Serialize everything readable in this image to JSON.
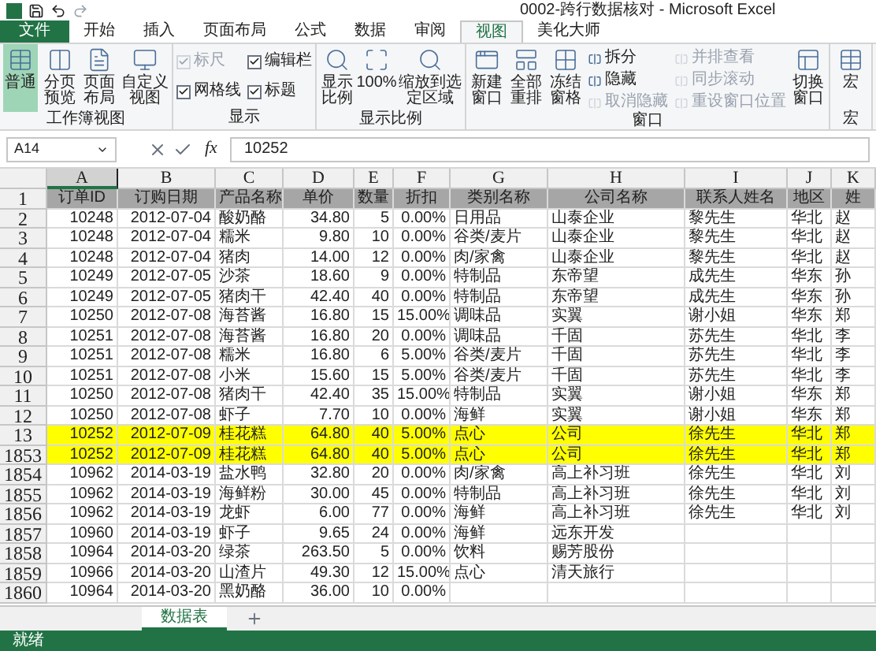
{
  "window": {
    "title": "0002-跨行数据核对 - Microsoft Excel"
  },
  "tabs": [
    {
      "label": "文件",
      "kind": "file",
      "selected": false
    },
    {
      "label": "开始",
      "kind": "tab",
      "selected": false
    },
    {
      "label": "插入",
      "kind": "tab",
      "selected": false
    },
    {
      "label": "页面布局",
      "kind": "tab",
      "selected": false
    },
    {
      "label": "公式",
      "kind": "tab",
      "selected": false
    },
    {
      "label": "数据",
      "kind": "tab",
      "selected": false
    },
    {
      "label": "审阅",
      "kind": "tab",
      "selected": false
    },
    {
      "label": "视图",
      "kind": "tab",
      "selected": true
    },
    {
      "label": "美化大师",
      "kind": "tab",
      "selected": false
    }
  ],
  "ribbon_groups": [
    {
      "label": "工作簿视图",
      "items": [
        {
          "kind": "large",
          "label": "普通",
          "selected": true
        },
        {
          "kind": "large",
          "label": "分页预览",
          "selected": false
        },
        {
          "kind": "large",
          "label": "页面布局",
          "selected": false
        },
        {
          "kind": "large",
          "label": "自定义视图",
          "selected": false
        }
      ]
    },
    {
      "label": "显示",
      "items": [
        {
          "kind": "check",
          "label": "标尺",
          "checked": true,
          "disabled": true
        },
        {
          "kind": "check",
          "label": "网格线",
          "checked": true,
          "disabled": false
        },
        {
          "kind": "check",
          "label": "编辑栏",
          "checked": true,
          "disabled": false
        },
        {
          "kind": "check",
          "label": "标题",
          "checked": true,
          "disabled": false
        }
      ]
    },
    {
      "label": "显示比例",
      "items": [
        {
          "kind": "large",
          "label": "显示比例",
          "selected": false
        },
        {
          "kind": "large",
          "label": "100%",
          "selected": false
        },
        {
          "kind": "large",
          "label": "缩放到选定区域",
          "selected": false
        }
      ]
    },
    {
      "label": "窗口",
      "items": [
        {
          "kind": "large",
          "label": "新建窗口",
          "selected": false
        },
        {
          "kind": "large",
          "label": "全部重排",
          "selected": false
        },
        {
          "kind": "large",
          "label": "冻结窗格",
          "selected": false
        },
        {
          "kind": "small",
          "label": "拆分",
          "disabled": false
        },
        {
          "kind": "small",
          "label": "隐藏",
          "disabled": false
        },
        {
          "kind": "small",
          "label": "取消隐藏",
          "disabled": true
        },
        {
          "kind": "small",
          "label": "并排查看",
          "disabled": true
        },
        {
          "kind": "small",
          "label": "同步滚动",
          "disabled": true
        },
        {
          "kind": "small",
          "label": "重设窗口位置",
          "disabled": true
        },
        {
          "kind": "large",
          "label": "切换窗口",
          "selected": false
        }
      ]
    },
    {
      "label": "宏",
      "items": [
        {
          "kind": "large",
          "label": "宏",
          "selected": false
        }
      ]
    }
  ],
  "formula_bar": {
    "name_box": "A14",
    "function_label": "fx",
    "value": "10252"
  },
  "columns": [
    {
      "label": "A",
      "selected": true
    },
    {
      "label": "B",
      "selected": false
    },
    {
      "label": "C",
      "selected": false
    },
    {
      "label": "D",
      "selected": false
    },
    {
      "label": "E",
      "selected": false
    },
    {
      "label": "F",
      "selected": false
    },
    {
      "label": "G",
      "selected": false
    },
    {
      "label": "H",
      "selected": false
    },
    {
      "label": "I",
      "selected": false
    },
    {
      "label": "J",
      "selected": false
    },
    {
      "label": "K",
      "selected": false
    }
  ],
  "rows": [
    {
      "header": "1",
      "kind": "heading",
      "highlighted": false,
      "cells": [
        "订单ID",
        "订购日期",
        "产品名称",
        "单价",
        "数量",
        "折扣",
        "类别名称",
        "公司名称",
        "联系人姓名",
        "地区",
        "姓"
      ]
    },
    {
      "header": "2",
      "kind": "data",
      "highlighted": false,
      "cells": [
        "10248",
        "2012-07-04",
        "酸奶酪",
        "34.80",
        "5",
        "0.00%",
        "日用品",
        "山泰企业",
        "黎先生",
        "华北",
        "赵"
      ]
    },
    {
      "header": "3",
      "kind": "data",
      "highlighted": false,
      "cells": [
        "10248",
        "2012-07-04",
        "糯米",
        "9.80",
        "10",
        "0.00%",
        "谷类/麦片",
        "山泰企业",
        "黎先生",
        "华北",
        "赵"
      ]
    },
    {
      "header": "4",
      "kind": "data",
      "highlighted": false,
      "cells": [
        "10248",
        "2012-07-04",
        "猪肉",
        "14.00",
        "12",
        "0.00%",
        "肉/家禽",
        "山泰企业",
        "黎先生",
        "华北",
        "赵"
      ]
    },
    {
      "header": "5",
      "kind": "data",
      "highlighted": false,
      "cells": [
        "10249",
        "2012-07-05",
        "沙茶",
        "18.60",
        "9",
        "0.00%",
        "特制品",
        "东帝望",
        "成先生",
        "华东",
        "孙"
      ]
    },
    {
      "header": "6",
      "kind": "data",
      "highlighted": false,
      "cells": [
        "10249",
        "2012-07-05",
        "猪肉干",
        "42.40",
        "40",
        "0.00%",
        "特制品",
        "东帝望",
        "成先生",
        "华东",
        "孙"
      ]
    },
    {
      "header": "7",
      "kind": "data",
      "highlighted": false,
      "cells": [
        "10250",
        "2012-07-08",
        "海苔酱",
        "16.80",
        "15",
        "15.00%",
        "调味品",
        "实翼",
        "谢小姐",
        "华东",
        "郑"
      ]
    },
    {
      "header": "8",
      "kind": "data",
      "highlighted": false,
      "cells": [
        "10251",
        "2012-07-08",
        "海苔酱",
        "16.80",
        "20",
        "0.00%",
        "调味品",
        "千固",
        "苏先生",
        "华北",
        "李"
      ]
    },
    {
      "header": "9",
      "kind": "data",
      "highlighted": false,
      "cells": [
        "10251",
        "2012-07-08",
        "糯米",
        "16.80",
        "6",
        "5.00%",
        "谷类/麦片",
        "千固",
        "苏先生",
        "华北",
        "李"
      ]
    },
    {
      "header": "10",
      "kind": "data",
      "highlighted": false,
      "cells": [
        "10251",
        "2012-07-08",
        "小米",
        "15.60",
        "15",
        "5.00%",
        "谷类/麦片",
        "千固",
        "苏先生",
        "华北",
        "李"
      ]
    },
    {
      "header": "11",
      "kind": "data",
      "highlighted": false,
      "cells": [
        "10250",
        "2012-07-08",
        "猪肉干",
        "42.40",
        "35",
        "15.00%",
        "特制品",
        "实翼",
        "谢小姐",
        "华东",
        "郑"
      ]
    },
    {
      "header": "12",
      "kind": "data",
      "highlighted": false,
      "cells": [
        "10250",
        "2012-07-08",
        "虾子",
        "7.70",
        "10",
        "0.00%",
        "海鲜",
        "实翼",
        "谢小姐",
        "华东",
        "郑"
      ]
    },
    {
      "header": "13",
      "kind": "data",
      "highlighted": true,
      "cells": [
        "10252",
        "2012-07-09",
        "桂花糕",
        "64.80",
        "40",
        "5.00%",
        "点心",
        "公司",
        "徐先生",
        "华北",
        "郑"
      ]
    },
    {
      "header": "1853",
      "kind": "data",
      "highlighted": true,
      "cells": [
        "10252",
        "2012-07-09",
        "桂花糕",
        "64.80",
        "40",
        "5.00%",
        "点心",
        "公司",
        "徐先生",
        "华北",
        "郑"
      ]
    },
    {
      "header": "1854",
      "kind": "data",
      "highlighted": false,
      "cells": [
        "10962",
        "2014-03-19",
        "盐水鸭",
        "32.80",
        "20",
        "0.00%",
        "肉/家禽",
        "高上补习班",
        "徐先生",
        "华北",
        "刘"
      ]
    },
    {
      "header": "1855",
      "kind": "data",
      "highlighted": false,
      "cells": [
        "10962",
        "2014-03-19",
        "海鲜粉",
        "30.00",
        "45",
        "0.00%",
        "特制品",
        "高上补习班",
        "徐先生",
        "华北",
        "刘"
      ]
    },
    {
      "header": "1856",
      "kind": "data",
      "highlighted": false,
      "cells": [
        "10962",
        "2014-03-19",
        "龙虾",
        "6.00",
        "77",
        "0.00%",
        "海鲜",
        "高上补习班",
        "徐先生",
        "华北",
        "刘"
      ]
    },
    {
      "header": "1857",
      "kind": "data",
      "highlighted": false,
      "cells": [
        "10960",
        "2014-03-19",
        "虾子",
        "9.65",
        "24",
        "0.00%",
        "海鲜",
        "远东开发"
      ]
    },
    {
      "header": "1858",
      "kind": "data",
      "highlighted": false,
      "cells": [
        "10964",
        "2014-03-20",
        "绿茶",
        "263.50",
        "5",
        "0.00%",
        "饮料",
        "赐芳股份"
      ]
    },
    {
      "header": "1859",
      "kind": "data",
      "highlighted": false,
      "cells": [
        "10966",
        "2014-03-20",
        "山渣片",
        "49.30",
        "12",
        "15.00%",
        "点心",
        "清天旅行"
      ]
    },
    {
      "header": "1860",
      "kind": "data",
      "highlighted": false,
      "cells": [
        "10964",
        "2014-03-20",
        "黑奶酪",
        "36.00",
        "10",
        "0.00%"
      ]
    }
  ],
  "sheet_tabs": [
    {
      "label": "数据表",
      "selected": true
    }
  ],
  "status_bar": {
    "text": "就绪"
  }
}
